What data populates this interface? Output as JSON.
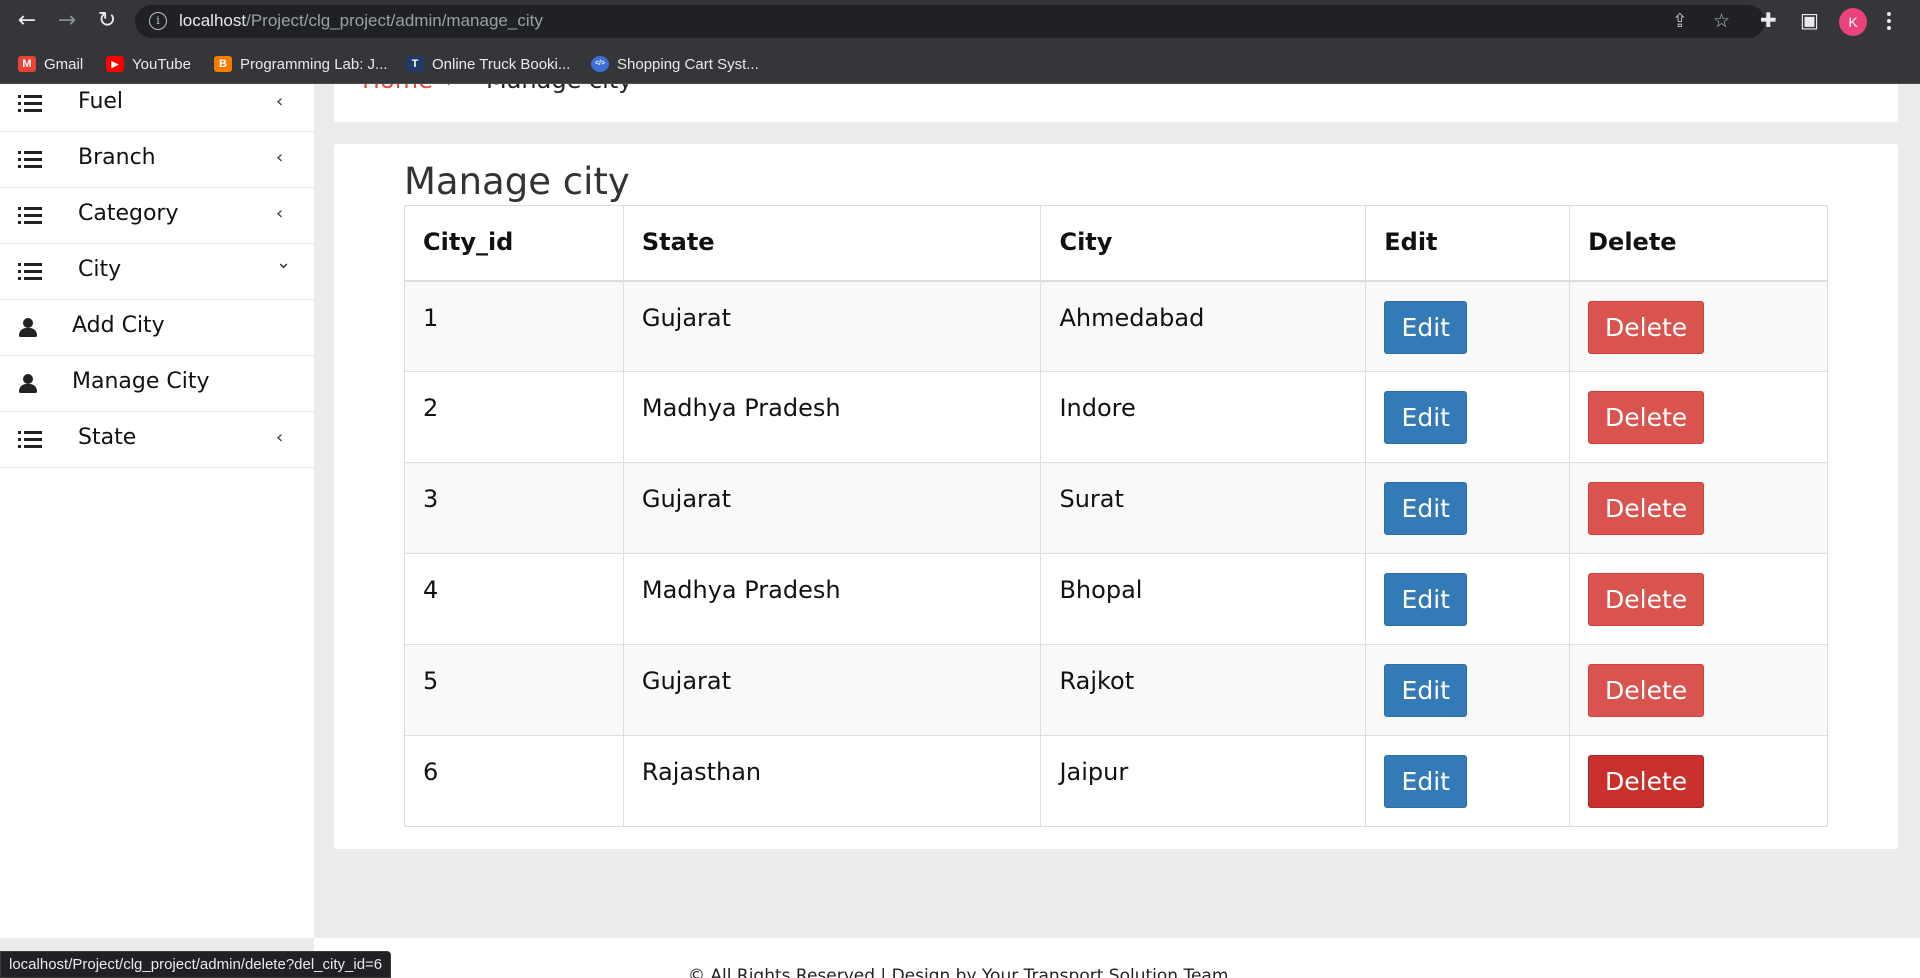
{
  "browser": {
    "back_glyph": "←",
    "forward_glyph": "→",
    "reload_glyph": "↻",
    "url_host": "localhost",
    "url_path": "/Project/clg_project/admin/manage_city",
    "profile_initial": "K",
    "bookmarks": [
      {
        "label": "Gmail",
        "icon": "gmail-icon",
        "icon_glyph": "M",
        "color": "#ea4335"
      },
      {
        "label": "YouTube",
        "icon": "youtube-icon",
        "icon_glyph": "▶",
        "color": "#ff0000"
      },
      {
        "label": "Programming Lab: J...",
        "icon": "blogger-icon",
        "icon_glyph": "B",
        "color": "#f57c00"
      },
      {
        "label": "Online Truck Booki...",
        "icon": "truck-site-icon",
        "icon_glyph": "T",
        "color": "#1f3b64"
      },
      {
        "label": "Shopping Cart Syst...",
        "icon": "code-icon",
        "icon_glyph": "</>",
        "color": "#3d6fd8"
      }
    ]
  },
  "sidebar": {
    "items": [
      {
        "label": "Fuel",
        "icon": "list-icon",
        "chevron": "‹",
        "expanded": false
      },
      {
        "label": "Branch",
        "icon": "list-icon",
        "chevron": "‹",
        "expanded": false
      },
      {
        "label": "Category",
        "icon": "list-icon",
        "chevron": "‹",
        "expanded": false
      },
      {
        "label": "City",
        "icon": "list-icon",
        "chevron": "⌄",
        "expanded": true
      },
      {
        "label": "Add City",
        "icon": "user-icon",
        "chevron": ""
      },
      {
        "label": "Manage City",
        "icon": "user-icon",
        "chevron": ""
      },
      {
        "label": "State",
        "icon": "list-icon",
        "chevron": "‹",
        "expanded": false
      }
    ]
  },
  "breadcrumb": {
    "home": "Home",
    "separator": "›",
    "current": "Manage city"
  },
  "main": {
    "title": "Manage city",
    "table": {
      "headers": [
        "City_id",
        "State",
        "City",
        "Edit",
        "Delete"
      ],
      "rows": [
        {
          "id": "1",
          "state": "Gujarat",
          "city": "Ahmedabad",
          "edit": "Edit",
          "delete": "Delete"
        },
        {
          "id": "2",
          "state": "Madhya Pradesh",
          "city": "Indore",
          "edit": "Edit",
          "delete": "Delete"
        },
        {
          "id": "3",
          "state": "Gujarat",
          "city": "Surat",
          "edit": "Edit",
          "delete": "Delete"
        },
        {
          "id": "4",
          "state": "Madhya Pradesh",
          "city": "Bhopal",
          "edit": "Edit",
          "delete": "Delete"
        },
        {
          "id": "5",
          "state": "Gujarat",
          "city": "Rajkot",
          "edit": "Edit",
          "delete": "Delete"
        },
        {
          "id": "6",
          "state": "Rajasthan",
          "city": "Jaipur",
          "edit": "Edit",
          "delete": "Delete",
          "delete_hovered": true
        }
      ]
    }
  },
  "footer": {
    "text": "© All Rights Reserved | Design by Your Transport Solution Team"
  },
  "status_bar": {
    "url": "localhost/Project/clg_project/admin/delete?del_city_id=6"
  },
  "colors": {
    "edit_button": "#337ab7",
    "delete_button": "#d9534f",
    "delete_button_hover": "#c9302c",
    "breadcrumb_home": "#e74c3c",
    "browser_chrome": "#35363a",
    "profile_avatar": "#e8437a"
  }
}
